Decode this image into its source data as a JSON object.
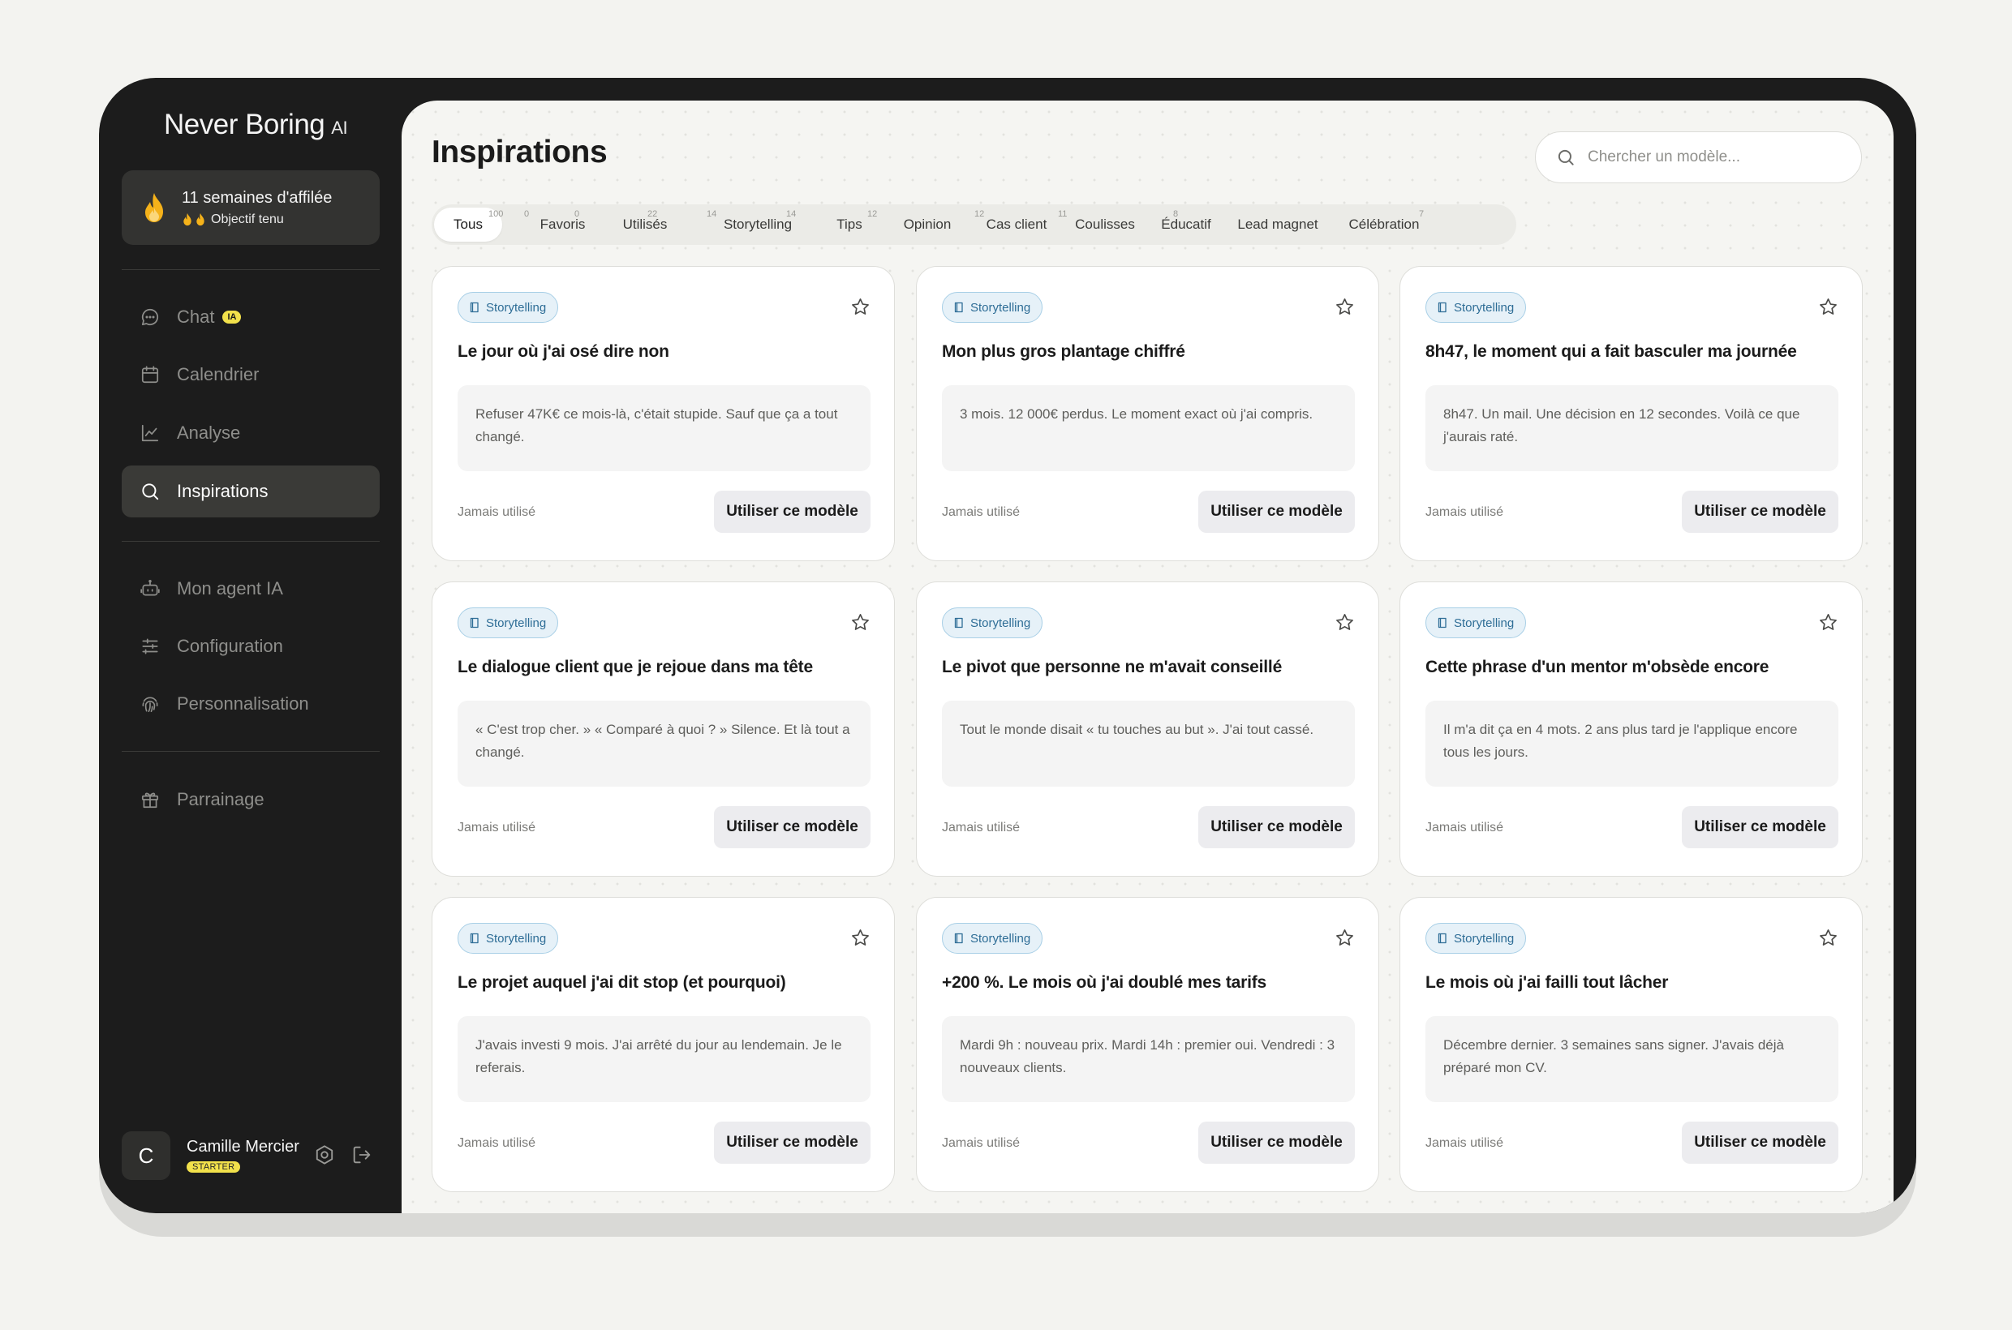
{
  "brand": {
    "name": "Never Boring",
    "suffix": "AI"
  },
  "streak": {
    "title": "11 semaines d'affilée",
    "subtitle": "Objectif tenu"
  },
  "nav": {
    "chat": "Chat",
    "chat_badge": "IA",
    "calendar": "Calendrier",
    "analytics": "Analyse",
    "inspirations": "Inspirations",
    "agent": "Mon agent IA",
    "configuration": "Configuration",
    "personalization": "Personnalisation",
    "referral": "Parrainage"
  },
  "user": {
    "initial": "C",
    "name": "Camille Mercier",
    "plan": "STARTER"
  },
  "page": {
    "title": "Inspirations",
    "search_placeholder": "Chercher un modèle..."
  },
  "filters": [
    {
      "label": "Tous",
      "count": "100"
    },
    {
      "label": "Favoris",
      "count": "0"
    },
    {
      "label": "Utilisés",
      "count": "0"
    },
    {
      "label": "Storytelling",
      "count": "22"
    },
    {
      "label": "Tips",
      "count": "14"
    },
    {
      "label": "Opinion",
      "count": "14"
    },
    {
      "label": "Cas client",
      "count": "12"
    },
    {
      "label": "Coulisses",
      "count": "12"
    },
    {
      "label": "Éducatif",
      "count": "11"
    },
    {
      "label": "Lead magnet",
      "count": "8"
    },
    {
      "label": "Célébration",
      "count": "7"
    }
  ],
  "cards": [
    {
      "tag": "Storytelling",
      "title": "Le jour où j'ai osé dire non",
      "excerpt": "Refuser 47K€ ce mois-là, c'était stupide. Sauf que ça a tout changé.",
      "usage": "Jamais utilisé",
      "button": "Utiliser ce modèle"
    },
    {
      "tag": "Storytelling",
      "title": "Mon plus gros plantage chiffré",
      "excerpt": "3 mois. 12 000€ perdus. Le moment exact où j'ai compris.",
      "usage": "Jamais utilisé",
      "button": "Utiliser ce modèle"
    },
    {
      "tag": "Storytelling",
      "title": "8h47, le moment qui a fait basculer ma journée",
      "excerpt": "8h47. Un mail. Une décision en 12 secondes. Voilà ce que j'aurais raté.",
      "usage": "Jamais utilisé",
      "button": "Utiliser ce modèle"
    },
    {
      "tag": "Storytelling",
      "title": "Le dialogue client que je rejoue dans ma tête",
      "excerpt": "« C'est trop cher. » « Comparé à quoi ? » Silence. Et là tout a changé.",
      "usage": "Jamais utilisé",
      "button": "Utiliser ce modèle"
    },
    {
      "tag": "Storytelling",
      "title": "Le pivot que personne ne m'avait conseillé",
      "excerpt": "Tout le monde disait « tu touches au but ». J'ai tout cassé.",
      "usage": "Jamais utilisé",
      "button": "Utiliser ce modèle"
    },
    {
      "tag": "Storytelling",
      "title": "Cette phrase d'un mentor m'obsède encore",
      "excerpt": "Il m'a dit ça en 4 mots. 2 ans plus tard je l'applique encore tous les jours.",
      "usage": "Jamais utilisé",
      "button": "Utiliser ce modèle"
    },
    {
      "tag": "Storytelling",
      "title": "Le projet auquel j'ai dit stop (et pourquoi)",
      "excerpt": "J'avais investi 9 mois. J'ai arrêté du jour au lendemain. Je le referais.",
      "usage": "Jamais utilisé",
      "button": "Utiliser ce modèle"
    },
    {
      "tag": "Storytelling",
      "title": "+200 %. Le mois où j'ai doublé mes tarifs",
      "excerpt": "Mardi 9h : nouveau prix. Mardi 14h : premier oui. Vendredi : 3 nouveaux clients.",
      "usage": "Jamais utilisé",
      "button": "Utiliser ce modèle"
    },
    {
      "tag": "Storytelling",
      "title": "Le mois où j'ai failli tout lâcher",
      "excerpt": "Décembre dernier. 3 semaines sans signer. J'avais déjà préparé mon CV.",
      "usage": "Jamais utilisé",
      "button": "Utiliser ce modèle"
    }
  ],
  "colors": {
    "accent_yellow": "#f2e14b",
    "tag_blue": "#2e6d96",
    "sidebar_bg": "#1c1c1c",
    "flame": "#f5b21a"
  }
}
